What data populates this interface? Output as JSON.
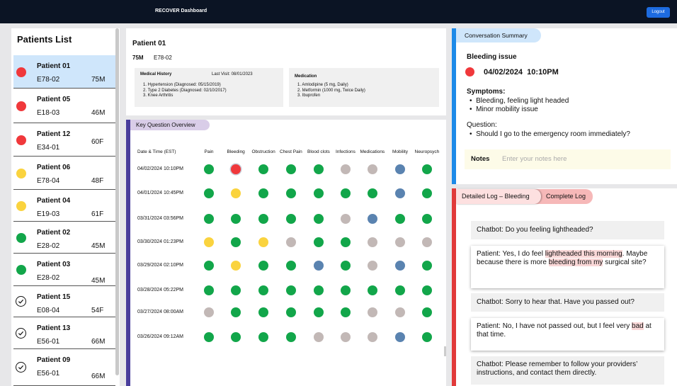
{
  "app": {
    "title": "RECOVER Dashboard",
    "logout_label": "Logout"
  },
  "patients": {
    "title": "Patients List",
    "items": [
      {
        "name": "Patient 01",
        "code": "E78-02",
        "age": "75M",
        "status": "red",
        "selected": true
      },
      {
        "name": "Patient 05",
        "code": "E18-03",
        "age": "46M",
        "status": "red"
      },
      {
        "name": "Patient 12",
        "code": "E34-01",
        "age": "60F",
        "status": "red"
      },
      {
        "name": "Patient 06",
        "code": "E78-04",
        "age": "48F",
        "status": "yellow"
      },
      {
        "name": "Patient 04",
        "code": "E19-03",
        "age": "61F",
        "status": "yellow"
      },
      {
        "name": "Patient 02",
        "code": "E28-02",
        "age": "45M",
        "status": "green"
      },
      {
        "name": "Patient 03",
        "code": "E28-02",
        "age": "45M",
        "status": "green"
      },
      {
        "name": "Patient 15",
        "code": "E08-04",
        "age": "54F",
        "status": "done"
      },
      {
        "name": "Patient 13",
        "code": "E56-01",
        "age": "66M",
        "status": "done"
      },
      {
        "name": "Patient 09",
        "code": "E56-01",
        "age": "66M",
        "status": "done"
      }
    ]
  },
  "patient": {
    "name": "Patient 01",
    "age_sex": "75M",
    "code": "E78-02",
    "history_title": "Medical History",
    "last_visit": "Last Visit: 08/01/2023",
    "history": [
      "1. Hypertension (Diagnosed: 05/15/2019)",
      "2. Type 2 Diabetes (Diagnosed: 02/10/2017)",
      "3. Knee Arthritis"
    ],
    "medication_title": "Medication",
    "medications": [
      "1. Amlodipine (5 mg, Daily)",
      "2. Metformin (1000 mg, Twice Daily)",
      "3. Ibuprofen"
    ]
  },
  "overview": {
    "title": "Key Question Overview",
    "date_header": "Date & Time (EST)",
    "columns": [
      "Pain",
      "Bleeding",
      "Obstruction",
      "Chest Pain",
      "Blood clots",
      "Infections",
      "Medications",
      "Mobility",
      "Neuropsych"
    ],
    "rows": [
      {
        "date": "04/02/2024 10:10PM",
        "values": [
          "green",
          "red",
          "green",
          "green",
          "green",
          "gray",
          "gray",
          "blue",
          "green"
        ]
      },
      {
        "date": "04/01/2024 10:45PM",
        "values": [
          "green",
          "yellow",
          "green",
          "green",
          "green",
          "green",
          "green",
          "blue",
          "green"
        ]
      },
      {
        "date": "03/31/2024 03:56PM",
        "values": [
          "green",
          "green",
          "green",
          "green",
          "green",
          "gray",
          "blue",
          "green",
          "green"
        ]
      },
      {
        "date": "03/30/2024 01:23PM",
        "values": [
          "yellow",
          "green",
          "yellow",
          "gray",
          "green",
          "green",
          "gray",
          "gray",
          "gray"
        ]
      },
      {
        "date": "03/29/2024 02:10PM",
        "values": [
          "green",
          "yellow",
          "green",
          "green",
          "blue",
          "green",
          "gray",
          "blue",
          "green"
        ]
      },
      {
        "date": "03/28/2024 05:22PM",
        "values": [
          "green",
          "green",
          "green",
          "green",
          "green",
          "green",
          "green",
          "green",
          "green"
        ]
      },
      {
        "date": "03/27/2024 08:00AM",
        "values": [
          "gray",
          "green",
          "green",
          "green",
          "green",
          "green",
          "gray",
          "gray",
          "green"
        ]
      },
      {
        "date": "03/26/2024 09:12AM",
        "values": [
          "green",
          "green",
          "green",
          "green",
          "gray",
          "gray",
          "gray",
          "blue",
          "green"
        ]
      }
    ]
  },
  "summary": {
    "tag": "Conversation Summary",
    "issue": "Bleeding issue",
    "datetime": "04/02/2024  10:10PM",
    "symptoms_label": "Symptoms:",
    "symptoms": [
      "Bleeding, feeling light headed",
      "Minor mobility issue"
    ],
    "question_label": "Question:",
    "questions": [
      "Should I go to the emergency room immediately?"
    ],
    "notes_label": "Notes",
    "notes_placeholder": "Enter your notes here"
  },
  "log": {
    "tab_detailed": "Detailed Log – Bleeding",
    "tab_complete": "Complete Log",
    "messages": [
      {
        "role": "bot",
        "parts": [
          {
            "t": "Chatbot: Do you feeling lightheaded?"
          }
        ]
      },
      {
        "role": "patient",
        "parts": [
          {
            "t": "Patient: Yes, I do feel "
          },
          {
            "t": "lightheaded this morning",
            "hl": true
          },
          {
            "t": ". Maybe because there is more "
          },
          {
            "t": "bleeding from my",
            "hl": true
          },
          {
            "t": " surgical site?"
          }
        ]
      },
      {
        "role": "bot",
        "parts": [
          {
            "t": "Chatbot: Sorry to hear that. Have you passed out?"
          }
        ]
      },
      {
        "role": "patient",
        "parts": [
          {
            "t": "Patient: No, I have not passed out, but I feel very "
          },
          {
            "t": "bad",
            "hl": true
          },
          {
            "t": " at that time."
          }
        ]
      },
      {
        "role": "bot",
        "parts": [
          {
            "t": "Chatbot: Please remember to follow your providers’ instructions, and contact them directly."
          }
        ]
      }
    ]
  },
  "colors": {
    "red": "#f0383b",
    "yellow": "#fad33e",
    "green": "#12a64a",
    "gray": "#c2b8b6",
    "blue": "#5a83b0"
  }
}
